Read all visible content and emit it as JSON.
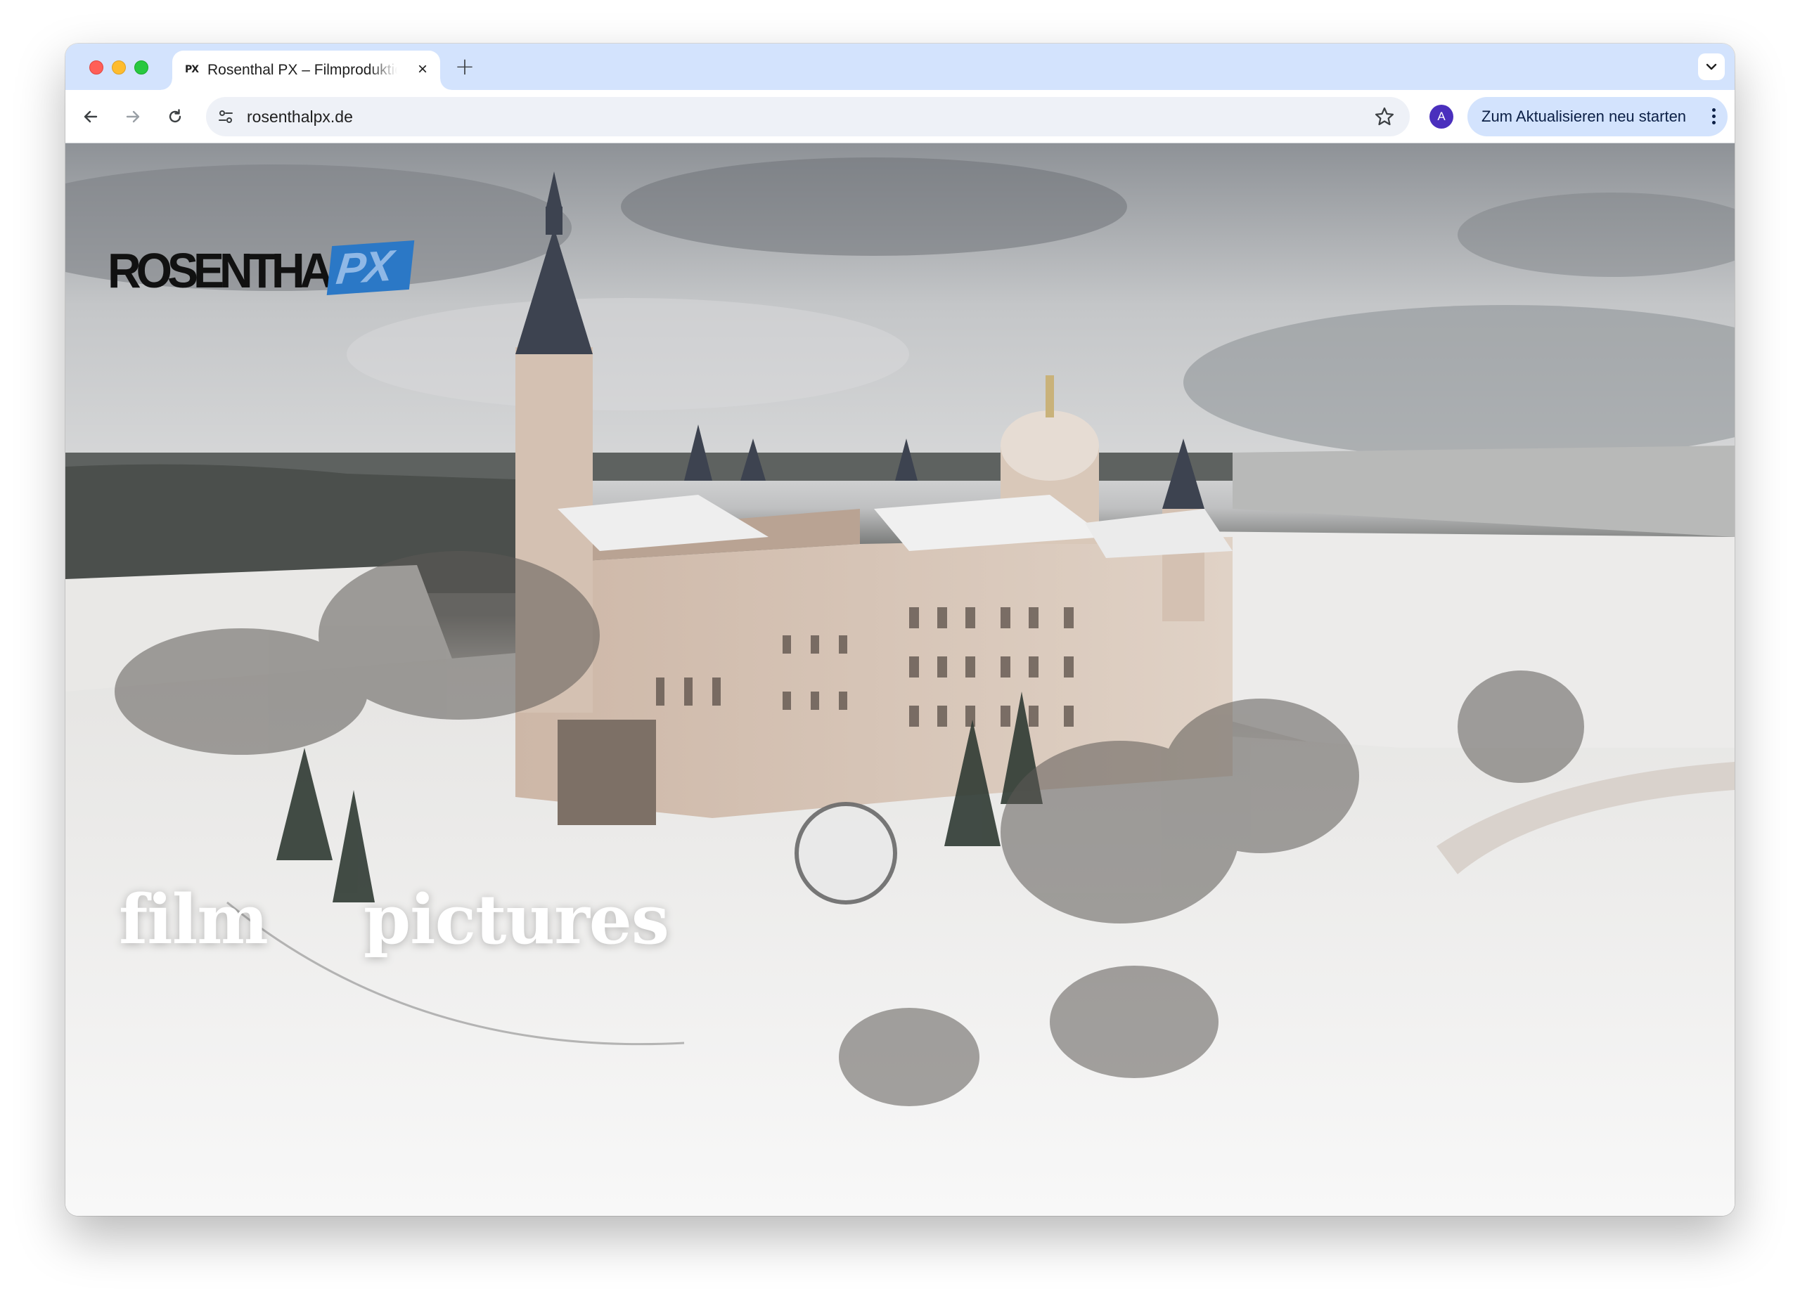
{
  "browser": {
    "tab": {
      "title": "Rosenthal PX – Filmproduktion",
      "favicon_text": "PX",
      "close_icon": "×"
    },
    "new_tab_icon": "+",
    "address_bar": {
      "url": "rosenthalpx.de"
    },
    "profile_initial": "A",
    "update_button_label": "Zum Aktualisieren neu starten"
  },
  "page": {
    "logo": {
      "main_text": "ROSENTHAL",
      "accent_text": "PX",
      "accent_color": "#2b78c6"
    },
    "nav": [
      {
        "label": "film"
      },
      {
        "label": "pictures"
      }
    ],
    "hero_image": "snow-covered castle aerial view"
  }
}
